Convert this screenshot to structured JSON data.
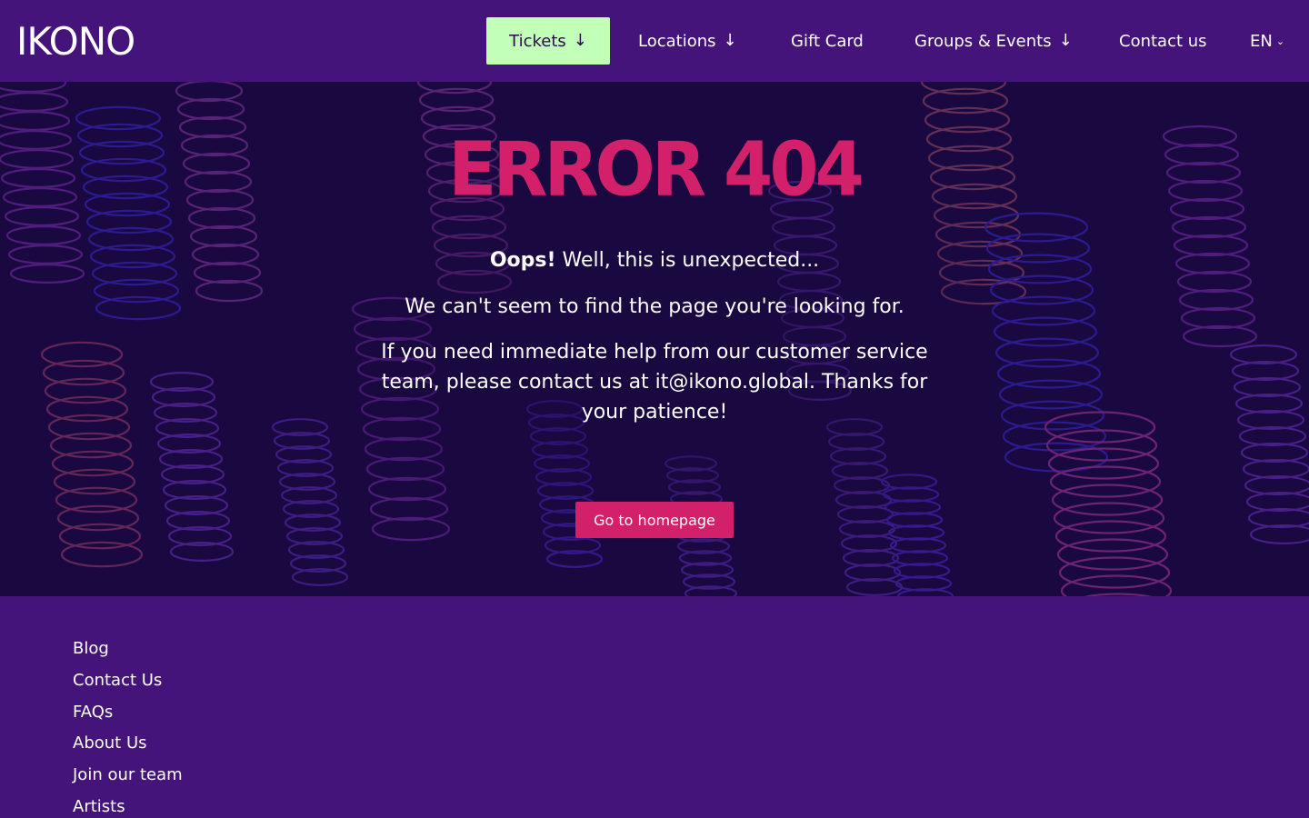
{
  "header": {
    "logo_text": "IKONO",
    "nav": {
      "tickets": "Tickets",
      "locations": "Locations",
      "gift_card": "Gift Card",
      "groups_events": "Groups & Events",
      "contact": "Contact us",
      "language": "EN"
    }
  },
  "hero": {
    "title": "ERROR 404",
    "oops": "Oops!",
    "line1_rest": " Well, this is unexpected...",
    "line2": "We can't seem to find the page you're looking for.",
    "line3": "If you need immediate help from our customer service team, please contact us at it@ikono.global. Thanks for your patience!",
    "button": "Go to homepage"
  },
  "footer": {
    "links": [
      "Blog",
      "Contact Us",
      "FAQs",
      "About Us",
      "Join our team",
      "Artists"
    ]
  },
  "colors": {
    "header_bg": "#44147a",
    "hero_bg": "#1a0840",
    "accent_pink": "#d3206b",
    "tickets_green": "#c2ffb8"
  }
}
